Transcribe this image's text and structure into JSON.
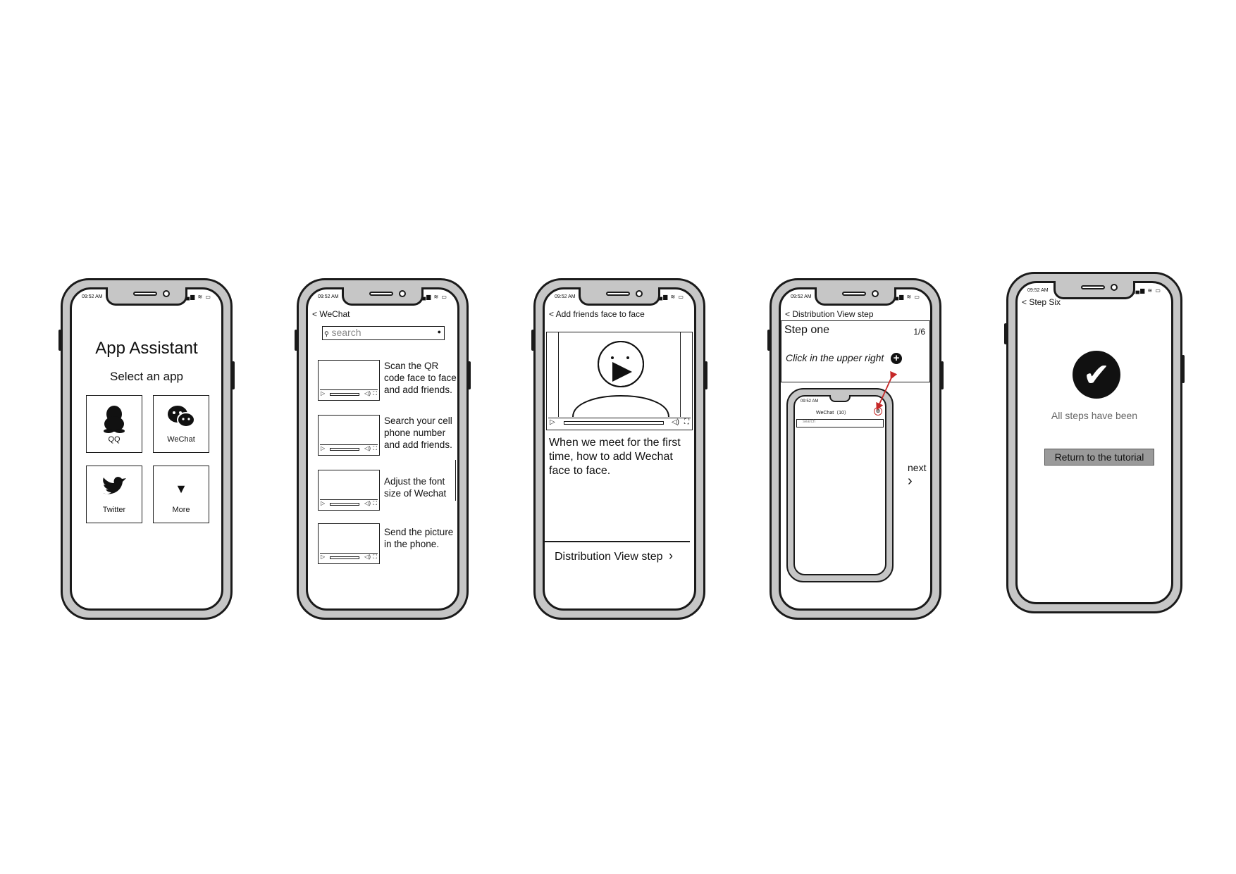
{
  "status": {
    "time": "09:52 AM",
    "icons": "signal-wifi-battery"
  },
  "phone1": {
    "title": "App Assistant",
    "subtitle": "Select an app",
    "apps": [
      {
        "label": "QQ",
        "icon": "qq-penguin-icon"
      },
      {
        "label": "WeChat",
        "icon": "wechat-icon"
      },
      {
        "label": "Twitter",
        "icon": "twitter-bird-icon"
      },
      {
        "label": "More",
        "icon": "triangle-down-icon"
      }
    ]
  },
  "phone2": {
    "back_label": "< WeChat",
    "search_placeholder": "search",
    "items": [
      {
        "text": "Scan the QR code face to face and add friends."
      },
      {
        "text": "Search your cell phone number and add friends."
      },
      {
        "text": "Adjust the font size of Wechat"
      },
      {
        "text": "Send the picture in the phone."
      }
    ]
  },
  "phone3": {
    "back_label": "< Add friends face to face",
    "description": "When we meet for the first time, how to add Wechat face to face.",
    "next_label": "Distribution View step"
  },
  "phone4": {
    "back_label": "< Distribution View step",
    "step_title": "Step one",
    "step_count": "1/6",
    "instruction": "Click in the upper right",
    "mini_header": "WeChat（10）",
    "mini_search": "search",
    "next_label": "next"
  },
  "phone5": {
    "back_label": "< Step Six",
    "done_text": "All steps have been",
    "return_label": "Return to the tutorial"
  }
}
